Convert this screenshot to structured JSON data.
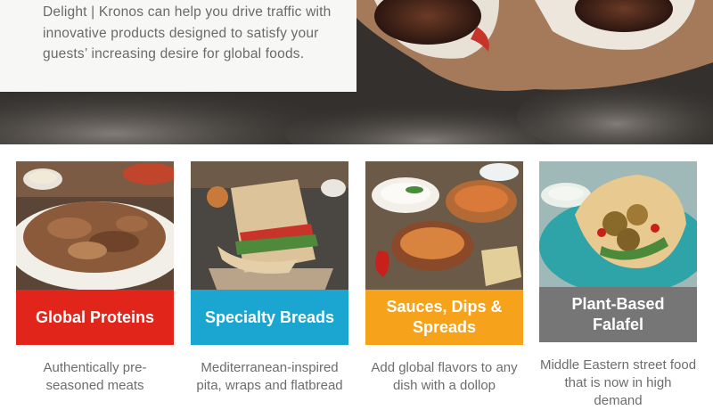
{
  "hero": {
    "text": "Delight | Kronos can help you drive traffic with innovative products designed to satisfy your guests’ increasing desire for global foods."
  },
  "cards": [
    {
      "title": "Global Proteins",
      "description": "Authentically pre-seasoned meats",
      "color": "#e1251b"
    },
    {
      "title": "Specialty Breads",
      "description": "Mediterranean-inspired pita, wraps and flatbread",
      "color": "#1aa6d1"
    },
    {
      "title": "Sauces, Dips & Spreads",
      "description": "Add global flavors to any dish with a dollop",
      "color": "#f6a31b"
    },
    {
      "title": "Plant-Based Falafel",
      "description": "Middle Eastern street food that is now in high demand",
      "color": "#767676"
    }
  ]
}
